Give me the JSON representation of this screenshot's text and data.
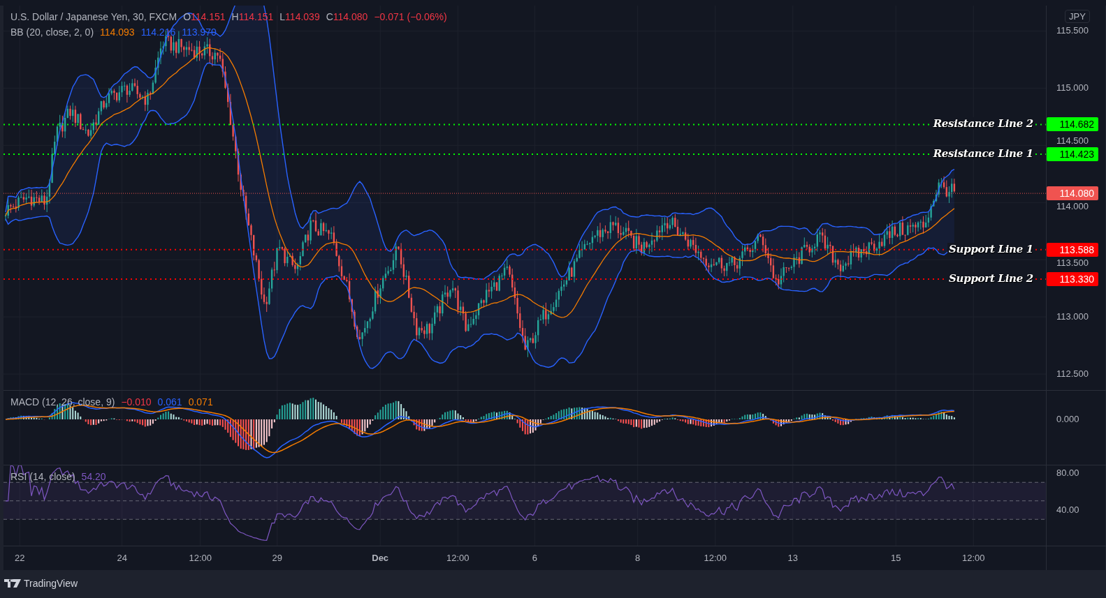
{
  "legend": {
    "symbol": "U.S. Dollar / Japanese Yen, 30, FXCM",
    "ohlc": [
      {
        "label": "O",
        "value": "114.151"
      },
      {
        "label": "H",
        "value": "114.151"
      },
      {
        "label": "L",
        "value": "114.039"
      },
      {
        "label": "C",
        "value": "114.080"
      }
    ],
    "change": "−0.071 (−0.06%)"
  },
  "bb": {
    "name": "BB (20, close, 2, 0)",
    "values": [
      {
        "text": "114.093",
        "color": "#f57c00"
      },
      {
        "text": "114.216",
        "color": "#2962ff"
      },
      {
        "text": "113.970",
        "color": "#2962ff"
      }
    ]
  },
  "currency_button": "JPY",
  "price_axis": [
    "115.500",
    "115.000",
    "114.500",
    "114.000",
    "113.500",
    "113.000",
    "112.500"
  ],
  "levels": [
    {
      "label": "Resistance Line 2",
      "price": "114.682",
      "color": "#00ff00"
    },
    {
      "label": "Resistance Line 1",
      "price": "114.423",
      "color": "#00ff00"
    },
    {
      "label": "Support Line 1",
      "price": "113.588",
      "color": "#ff0000"
    },
    {
      "label": "Support Line 2",
      "price": "113.330",
      "color": "#ff0000"
    }
  ],
  "current_price": {
    "price": "114.080",
    "color": "#f05350"
  },
  "macd": {
    "name": "MACD (12, 26, close, 9)",
    "values": [
      {
        "text": "−0.010",
        "color": "#f23645"
      },
      {
        "text": "0.061",
        "color": "#2962ff"
      },
      {
        "text": "0.071",
        "color": "#f57c00"
      }
    ],
    "axis": [
      "0.000"
    ]
  },
  "rsi": {
    "name": "RSI (14, close)",
    "value": "54.20",
    "axis": [
      "80.00",
      "40.00"
    ]
  },
  "time_axis": [
    {
      "label": "22",
      "kind": "day"
    },
    {
      "label": "24",
      "kind": "day"
    },
    {
      "label": "12:00",
      "kind": "time"
    },
    {
      "label": "29",
      "kind": "day"
    },
    {
      "label": "Dec",
      "kind": "month"
    },
    {
      "label": "12:00",
      "kind": "time"
    },
    {
      "label": "6",
      "kind": "day"
    },
    {
      "label": "8",
      "kind": "day"
    },
    {
      "label": "12:00",
      "kind": "time"
    },
    {
      "label": "13",
      "kind": "day"
    },
    {
      "label": "15",
      "kind": "day"
    },
    {
      "label": "12:00",
      "kind": "time"
    }
  ],
  "footer": {
    "brand": "TradingView"
  }
}
